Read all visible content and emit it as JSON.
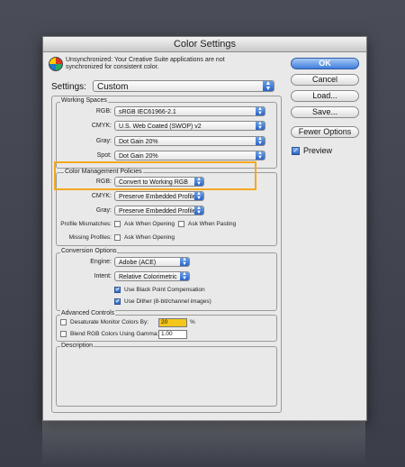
{
  "window": {
    "title": "Color Settings"
  },
  "sync_message": "Unsynchronized: Your Creative Suite applications are not synchronized for consistent color.",
  "settings": {
    "label": "Settings:",
    "value": "Custom"
  },
  "working_spaces": {
    "title": "Working Spaces",
    "rgb_label": "RGB:",
    "rgb_value": "sRGB IEC61966-2.1",
    "cmyk_label": "CMYK:",
    "cmyk_value": "U.S. Web Coated (SWOP) v2",
    "gray_label": "Gray:",
    "gray_value": "Dot Gain 20%",
    "spot_label": "Spot:",
    "spot_value": "Dot Gain 20%"
  },
  "policies": {
    "title": "Color Management Policies",
    "rgb_label": "RGB:",
    "rgb_value": "Convert to Working RGB",
    "cmyk_label": "CMYK:",
    "cmyk_value": "Preserve Embedded Profiles",
    "gray_label": "Gray:",
    "gray_value": "Preserve Embedded Profiles",
    "mismatch_label": "Profile Mismatches:",
    "ask_opening": "Ask When Opening",
    "ask_pasting": "Ask When Pasting",
    "missing_label": "Missing Profiles:",
    "ask_opening_missing": "Ask When Opening"
  },
  "conversion": {
    "title": "Conversion Options",
    "engine_label": "Engine:",
    "engine_value": "Adobe (ACE)",
    "intent_label": "Intent:",
    "intent_value": "Relative Colorimetric",
    "bpc": "Use Black Point Compensation",
    "dither": "Use Dither (8-bit/channel images)"
  },
  "advanced": {
    "title": "Advanced Controls",
    "desaturate": "Desaturate Monitor Colors By:",
    "desaturate_value": "20",
    "percent": "%",
    "blend": "Blend RGB Colors Using Gamma:",
    "blend_value": "1.00"
  },
  "description": {
    "title": "Description"
  },
  "buttons": {
    "ok": "OK",
    "cancel": "Cancel",
    "load": "Load...",
    "save": "Save...",
    "fewer": "Fewer Options",
    "preview": "Preview"
  },
  "colors": {
    "highlight": "#f3a91e",
    "accent": "#2b63c8"
  }
}
